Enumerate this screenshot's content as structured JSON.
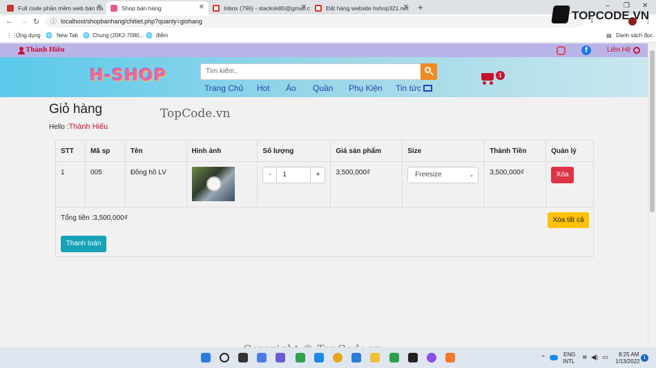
{
  "browser": {
    "tabs": [
      {
        "title": "Full code phần mềm web bán hà"
      },
      {
        "title": "Shop bán hàng"
      },
      {
        "title": "Inbox (796) - stackskill0@gmail.c"
      },
      {
        "title": "Đặt hàng website hshop321.net"
      }
    ],
    "new_tab": "+",
    "url": "localhost/shopbanhang/chitiet.php?quanly=giohang",
    "bookmarks": [
      "Ứng dụng",
      "New Tab",
      "Chung (20K2-7080...",
      "điểm"
    ],
    "reading_list": "Danh sách đọc",
    "watermark_logo": "TOPCODE.VN"
  },
  "site": {
    "user_name": "Thành Hiếu",
    "contact": "Liên Hệ",
    "logo": "H-SHOP",
    "search_placeholder": "Tìm kiếm..",
    "menu": [
      "Trang Chủ",
      "Hot",
      "Áo",
      "Quần",
      "Phụ Kiện",
      "Tin tức"
    ],
    "cart_count": "1",
    "colors": {
      "accent": "#f08b24",
      "link": "#2b3fb0",
      "danger": "#dc3545",
      "warning": "#ffc107",
      "info": "#17a2b8"
    }
  },
  "cart": {
    "title": "Giỏ hàng",
    "hello_label": "Hello :",
    "hello_name": "Thành Hiếu",
    "columns": [
      "STT",
      "Mã sp",
      "Tên",
      "Hình ảnh",
      "Số lượng",
      "Giá sản phẩm",
      "Size",
      "Thành Tiền",
      "Quản lý"
    ],
    "rows": [
      {
        "stt": "1",
        "code": "005",
        "name": "Đồng hồ LV",
        "qty": "1",
        "price": "3,500,000₫",
        "size": "Freesize",
        "total": "3,500,000₫",
        "action": "Xóa"
      }
    ],
    "qty_minus": "-",
    "qty_plus": "+",
    "total_label": "Tổng tiền :3,500,000₫",
    "clear_all": "Xóa tất cả",
    "checkout": "Thanh toán"
  },
  "watermarks": {
    "center": "TopCode.vn",
    "bottom": "Copyright © TopCode.vn"
  },
  "taskbar": {
    "lang": "ENG",
    "region": "INTL",
    "time": "8:25 AM",
    "date": "1/13/2022",
    "notif": "1"
  }
}
